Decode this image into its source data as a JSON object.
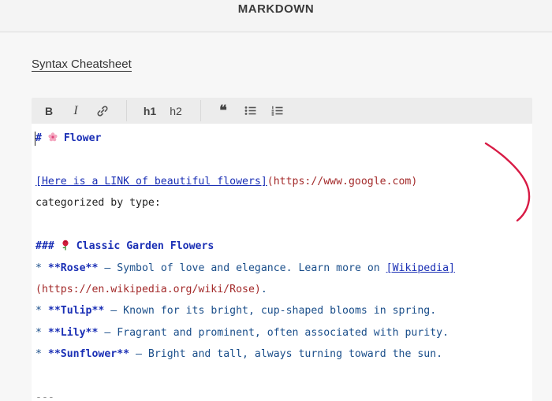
{
  "header": {
    "title": "MARKDOWN"
  },
  "main": {
    "cheatsheet_label": "Syntax Cheatsheet"
  },
  "toolbar": {
    "bold_label": "B",
    "italic_label": "I",
    "h1_label": "h1",
    "h2_label": "h2",
    "quote_label": "❝",
    "icons": [
      "link-icon",
      "unordered-list-icon",
      "ordered-list-icon"
    ]
  },
  "editor": {
    "line1": {
      "hash": "# ",
      "text": " Flower"
    },
    "line2": {
      "link_text": "[Here is a LINK of beautiful flowers]",
      "url": "(https://www.google.com)"
    },
    "line3": "categorized by type:",
    "line4": {
      "hash": "### ",
      "text": " Classic Garden Flowers"
    },
    "items": [
      {
        "bullet": "* ",
        "bold": "**Rose**",
        "desc": " — Symbol of love and elegance. Learn more on ",
        "link": "[Wikipedia]"
      },
      {
        "url_cont": "(https://en.wikipedia.org/wiki/Rose)",
        "tail": "."
      },
      {
        "bullet": "* ",
        "bold": "**Tulip**",
        "desc": " — Known for its bright, cup-shaped blooms in spring."
      },
      {
        "bullet": "* ",
        "bold": "**Lily**",
        "desc": " — Fragrant and prominent, often associated with purity."
      },
      {
        "bullet": "* ",
        "bold": "**Sunflower**",
        "desc": " — Bright and tall, always turning toward the sun."
      }
    ],
    "hr": "---"
  },
  "colors": {
    "heading": "#1a2fb5",
    "url": "#a32a2a",
    "annotation": "#d81b45"
  }
}
